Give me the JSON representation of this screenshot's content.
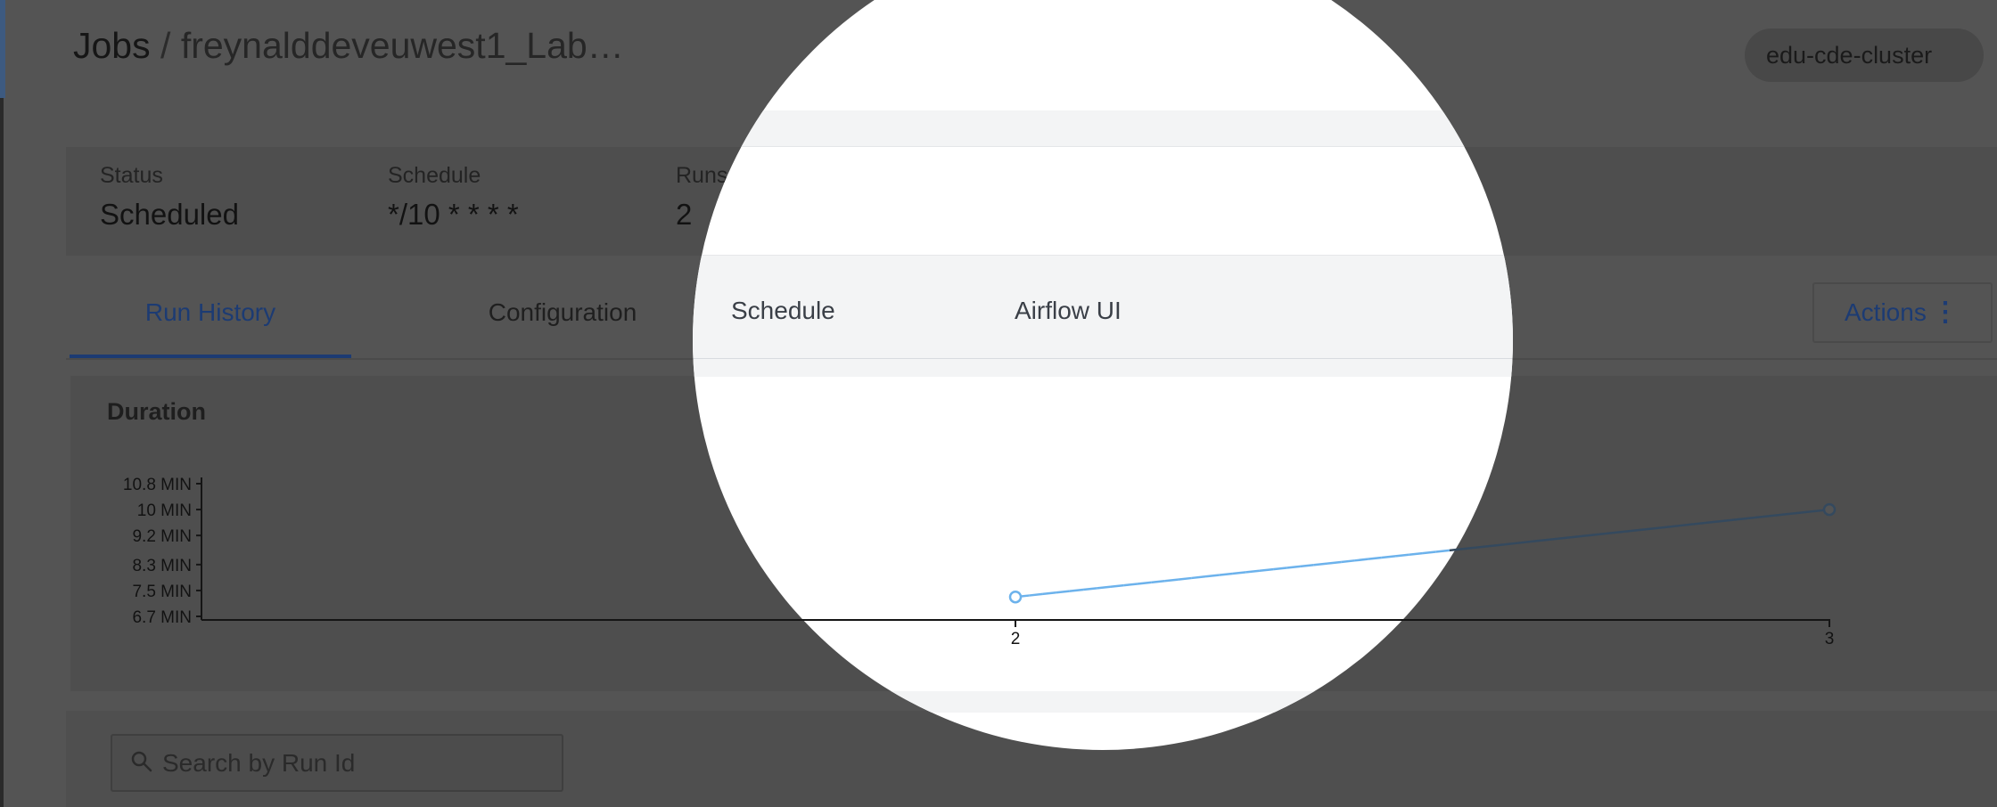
{
  "header": {
    "jobs_crumb": "Jobs",
    "separator": "/",
    "job_name": "freynalddeveuwest1_Lab…",
    "cluster": "edu-cde-cluster"
  },
  "summary": {
    "status_label": "Status",
    "status_value": "Scheduled",
    "schedule_label": "Schedule",
    "schedule_value": "*/10 * * * *",
    "runs_label": "Runs",
    "runs_value": "2"
  },
  "tabs": [
    {
      "label": "Run History",
      "active": true
    },
    {
      "label": "Configuration",
      "active": false
    },
    {
      "label": "Schedule",
      "active": false
    },
    {
      "label": "Airflow UI",
      "active": false
    }
  ],
  "actions": {
    "label": "Actions"
  },
  "search": {
    "placeholder": "Search by Run Id"
  },
  "colors": {
    "accent": "#1c3b73",
    "line": "#6cb2ec",
    "line_dimmed": "#34495e",
    "overlay_bg": "#545454"
  },
  "icons": [
    "search-icon",
    "kebab-menu-icon"
  ],
  "chart_data": {
    "type": "line",
    "title": "Duration",
    "x": [
      2,
      3
    ],
    "x_ticks": [
      "2",
      "3"
    ],
    "y_ticks": [
      "10.8 MIN",
      "10 MIN",
      "9.2 MIN",
      "8.3 MIN",
      "7.5 MIN",
      "6.7 MIN"
    ],
    "y_tick_values": [
      10.8,
      10.0,
      9.2,
      8.3,
      7.5,
      6.7
    ],
    "ylim": [
      6.7,
      10.8
    ],
    "series": [
      {
        "values": [
          7.3,
          10.0
        ]
      }
    ],
    "grid": false,
    "legend": "none"
  }
}
